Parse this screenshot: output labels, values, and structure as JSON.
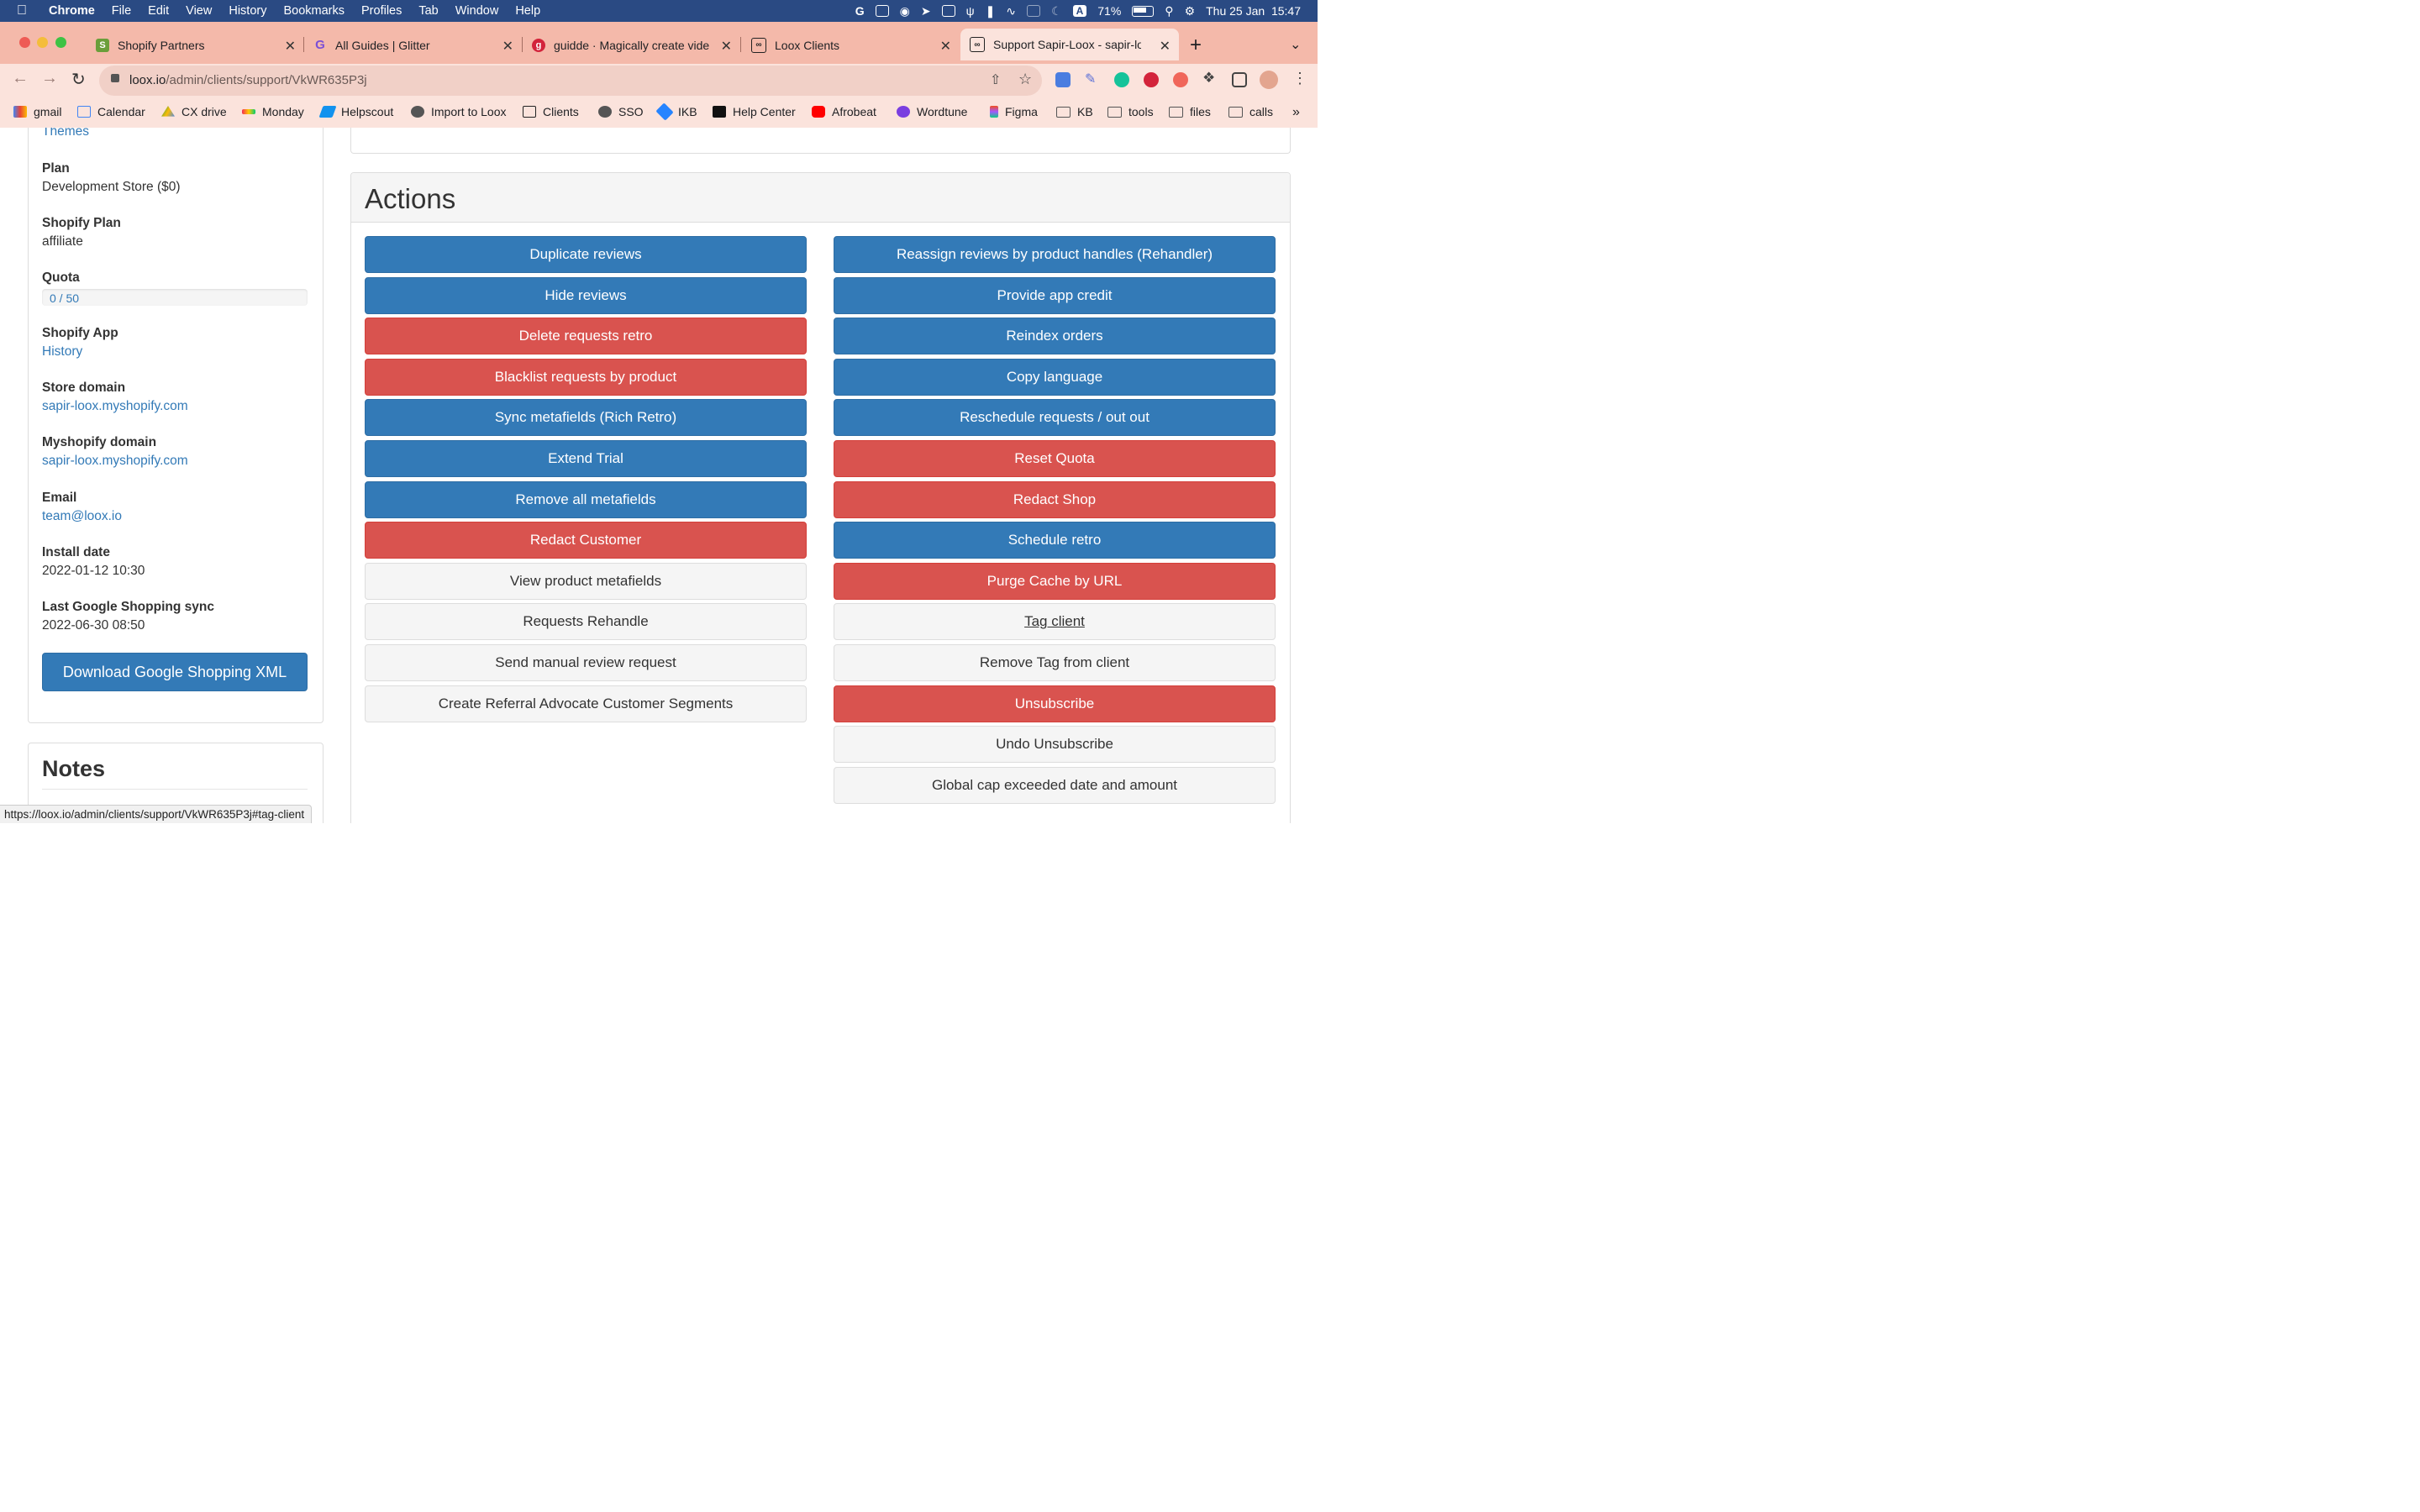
{
  "menubar": {
    "app": "Chrome",
    "items": [
      "File",
      "Edit",
      "View",
      "History",
      "Bookmarks",
      "Profiles",
      "Tab",
      "Window",
      "Help"
    ],
    "battery": "71%",
    "clock": "Thu 25 Jan  15:47"
  },
  "tabs": [
    {
      "title": "Shopify Partners"
    },
    {
      "title": "All Guides | Glitter"
    },
    {
      "title": "guidde · Magically create vide"
    },
    {
      "title": "Loox Clients"
    },
    {
      "title": "Support Sapir-Loox - sapir-loo"
    }
  ],
  "toolbar": {
    "url_host": "loox.io",
    "url_path": "/admin/clients/support/VkWR635P3j"
  },
  "bookmarks": [
    "gmail",
    "Calendar",
    "CX drive",
    "Monday",
    "Helpscout",
    "Import to Loox",
    "Clients",
    "SSO",
    "IKB",
    "Help Center",
    "Afrobeat",
    "Wordtune",
    "Figma",
    "KB",
    "tools",
    "files",
    "calls"
  ],
  "client": {
    "themes_link": "Themes",
    "plan_label": "Plan",
    "plan_value": "Development Store ($0)",
    "shopify_plan_label": "Shopify Plan",
    "shopify_plan_value": "affiliate",
    "quota_label": "Quota",
    "quota_value": "0 / 50",
    "quota_fraction": 0,
    "shopify_app_label": "Shopify App",
    "shopify_app_value": "History",
    "store_domain_label": "Store domain",
    "store_domain_value": "sapir-loox.myshopify.com",
    "myshopify_label": "Myshopify domain",
    "myshopify_value": "sapir-loox.myshopify.com",
    "email_label": "Email",
    "email_value": "team@loox.io",
    "install_label": "Install date",
    "install_value": "2022-01-12 10:30",
    "gsync_label": "Last Google Shopping sync",
    "gsync_value": "2022-06-30 08:50",
    "download_btn": "Download Google Shopping XML"
  },
  "notes": {
    "title": "Notes"
  },
  "actions": {
    "title": "Actions",
    "left": [
      {
        "label": "Duplicate reviews",
        "style": "primary"
      },
      {
        "label": "Hide reviews",
        "style": "primary"
      },
      {
        "label": "Delete requests retro",
        "style": "danger"
      },
      {
        "label": "Blacklist requests by product",
        "style": "danger"
      },
      {
        "label": "Sync metafields (Rich Retro)",
        "style": "primary"
      },
      {
        "label": "Extend Trial",
        "style": "primary"
      },
      {
        "label": "Remove all metafields",
        "style": "primary"
      },
      {
        "label": "Redact Customer",
        "style": "danger"
      },
      {
        "label": "View product metafields",
        "style": "default"
      },
      {
        "label": "Requests Rehandle",
        "style": "default"
      },
      {
        "label": "Send manual review request",
        "style": "default"
      },
      {
        "label": "Create Referral Advocate Customer Segments",
        "style": "default"
      }
    ],
    "right": [
      {
        "label": "Reassign reviews by product handles (Rehandler)",
        "style": "primary"
      },
      {
        "label": "Provide app credit",
        "style": "primary"
      },
      {
        "label": "Reindex orders",
        "style": "primary"
      },
      {
        "label": "Copy language",
        "style": "primary"
      },
      {
        "label": "Reschedule requests / out out",
        "style": "primary"
      },
      {
        "label": "Reset Quota",
        "style": "danger"
      },
      {
        "label": "Redact Shop",
        "style": "danger"
      },
      {
        "label": "Schedule retro",
        "style": "primary"
      },
      {
        "label": "Purge Cache by URL",
        "style": "danger"
      },
      {
        "label": "Tag client",
        "style": "default link"
      },
      {
        "label": "Remove Tag from client",
        "style": "default"
      },
      {
        "label": "Unsubscribe",
        "style": "danger"
      },
      {
        "label": "Undo Unsubscribe",
        "style": "default"
      },
      {
        "label": "Global cap exceeded date and amount",
        "style": "default"
      }
    ]
  },
  "status_url": "https://loox.io/admin/clients/support/VkWR635P3j#tag-client",
  "colors": {
    "primary": "#337ab7",
    "danger": "#d9534f",
    "default": "#f5f5f5",
    "menubar": "#2a4a83",
    "tabstrip": "#f4b9aa"
  }
}
